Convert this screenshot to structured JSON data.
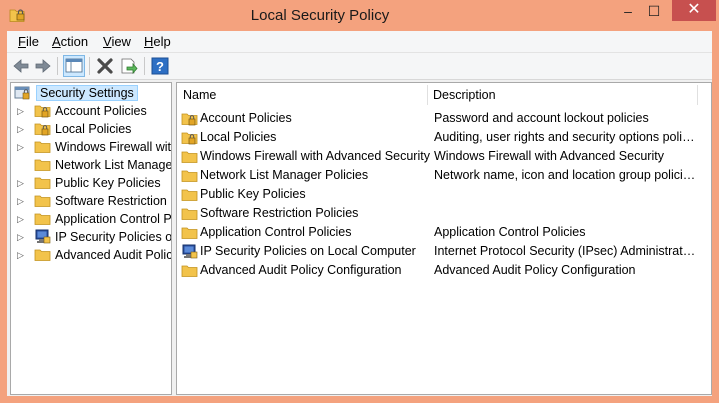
{
  "window": {
    "title": "Local Security Policy",
    "controls": {
      "minimize": "–",
      "maximize": "☐",
      "close": "✕"
    }
  },
  "menubar": {
    "items": [
      {
        "label": "File",
        "accel": "F",
        "rest": "ile"
      },
      {
        "label": "Action",
        "accel": "A",
        "rest": "ction"
      },
      {
        "label": "View",
        "accel": "V",
        "rest": "iew"
      },
      {
        "label": "Help",
        "accel": "H",
        "rest": "elp"
      }
    ]
  },
  "toolbar": {
    "icons": [
      "back-arrow-icon",
      "forward-arrow-icon",
      "show-hide-console-tree-icon",
      "delete-icon",
      "export-list-icon",
      "help-icon"
    ],
    "help_glyph": "?"
  },
  "tree": {
    "root": "Security Settings",
    "items": [
      {
        "label": "Account Policies",
        "icon": "folder-lock-icon"
      },
      {
        "label": "Local Policies",
        "icon": "folder-lock-icon"
      },
      {
        "label": "Windows Firewall with",
        "icon": "folder-icon"
      },
      {
        "label": "Network List Manager",
        "icon": "folder-icon"
      },
      {
        "label": "Public Key Policies",
        "icon": "folder-icon"
      },
      {
        "label": "Software Restriction Po",
        "icon": "folder-icon"
      },
      {
        "label": "Application Control Po",
        "icon": "folder-icon"
      },
      {
        "label": "IP Security Policies on",
        "icon": "ip-security-icon"
      },
      {
        "label": "Advanced Audit Policy",
        "icon": "folder-icon"
      }
    ]
  },
  "list": {
    "columns": {
      "name": "Name",
      "description": "Description"
    },
    "rows": [
      {
        "name": "Account Policies",
        "description": "Password and account lockout policies",
        "icon": "folder-lock-icon"
      },
      {
        "name": "Local Policies",
        "description": "Auditing, user rights and security options polici...",
        "icon": "folder-lock-icon"
      },
      {
        "name": "Windows Firewall with Advanced Security",
        "description": "Windows Firewall with Advanced Security",
        "icon": "folder-icon"
      },
      {
        "name": "Network List Manager Policies",
        "description": "Network name, icon and location group policies.",
        "icon": "folder-icon"
      },
      {
        "name": "Public Key Policies",
        "description": "",
        "icon": "folder-icon"
      },
      {
        "name": "Software Restriction Policies",
        "description": "",
        "icon": "folder-icon"
      },
      {
        "name": "Application Control Policies",
        "description": "Application Control Policies",
        "icon": "folder-icon"
      },
      {
        "name": "IP Security Policies on Local Computer",
        "description": "Internet Protocol Security (IPsec) Administratio...",
        "icon": "ip-security-icon"
      },
      {
        "name": "Advanced Audit Policy Configuration",
        "description": "Advanced Audit Policy Configuration",
        "icon": "folder-icon"
      }
    ]
  },
  "colors": {
    "frame": "#f4a27e",
    "close_button": "#c7504f",
    "selection": "#cce8ff",
    "folder": "#f2c34b"
  }
}
